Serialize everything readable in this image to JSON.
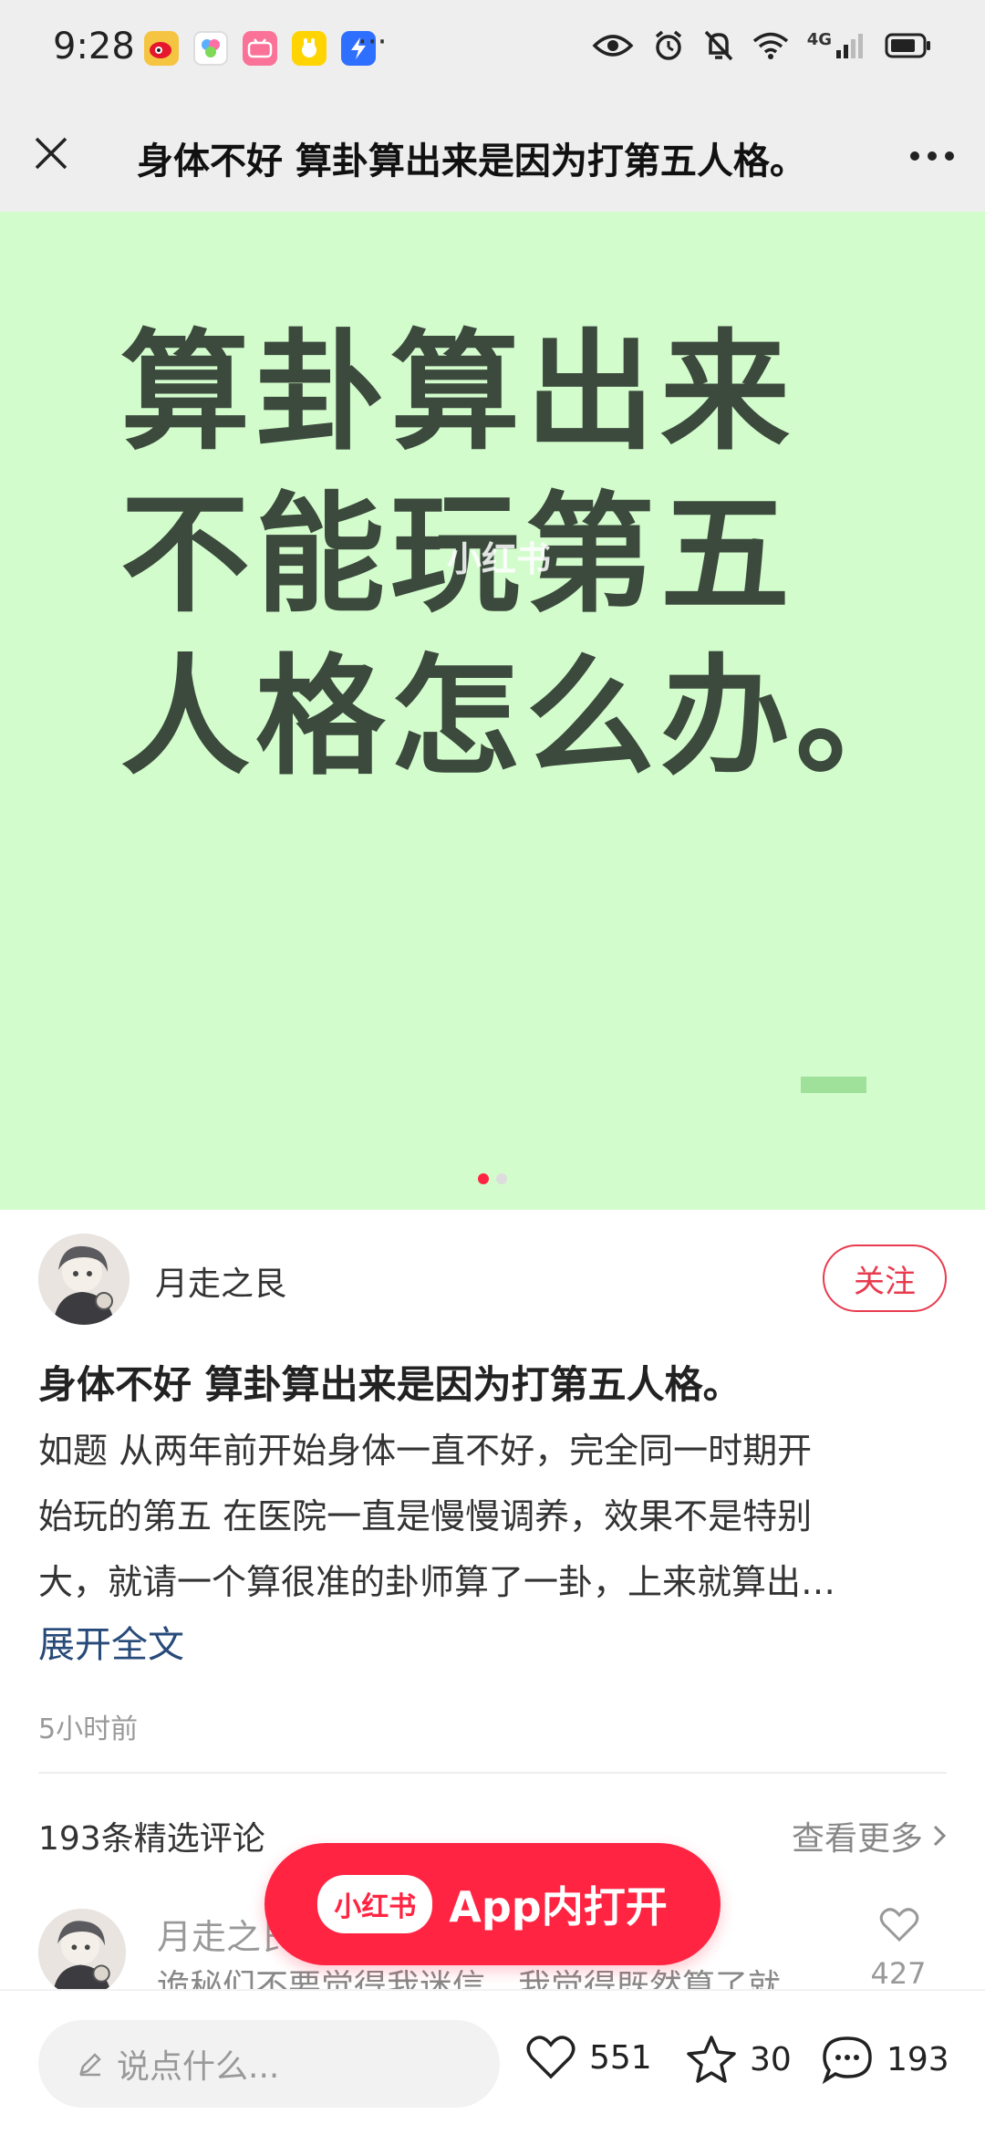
{
  "status_bar": {
    "time": "9:28",
    "more_dots": "···",
    "network": "4G",
    "app_icons": [
      "weibo-icon",
      "app-icon-2",
      "bilibili-icon",
      "app-icon-4",
      "app-icon-5"
    ]
  },
  "nav": {
    "title": "身体不好 算卦算出来是因为打第五人格。"
  },
  "hero": {
    "lines": [
      "算卦算出来",
      "不能玩第五",
      "人格怎么办。"
    ],
    "watermark": "小红书",
    "background_color": "#d3fccd",
    "text_color": "#3b4a3c",
    "carousel": {
      "total": 2,
      "active": 1
    }
  },
  "author": {
    "name": "月走之艮",
    "follow_label": "关注"
  },
  "post": {
    "title": "身体不好 算卦算出来是因为打第五人格。",
    "body_lines": [
      "如题 从两年前开始身体一直不好，完全同一时期开",
      "始玩的第五 在医院一直是慢慢调养，效果不是特别",
      "大，就请一个算很准的卦师算了一卦，上来就算出…"
    ],
    "expand_label": "展开全文",
    "time": "5小时前"
  },
  "comments": {
    "count_label": "193条精选评论",
    "see_more_label": "查看更多",
    "first": {
      "author": "月走之艮",
      "text": "诡秘们不要觉得我迷信，我觉得既然算了就",
      "likes": "427"
    }
  },
  "open_in_app": {
    "logo": "小红书",
    "label": "App内打开"
  },
  "bottom_bar": {
    "input_placeholder": "说点什么...",
    "likes": "551",
    "favorites": "30",
    "comments": "193"
  },
  "colors": {
    "accent": "#ff2442",
    "follow": "#e83b4e",
    "link": "#274a79"
  }
}
